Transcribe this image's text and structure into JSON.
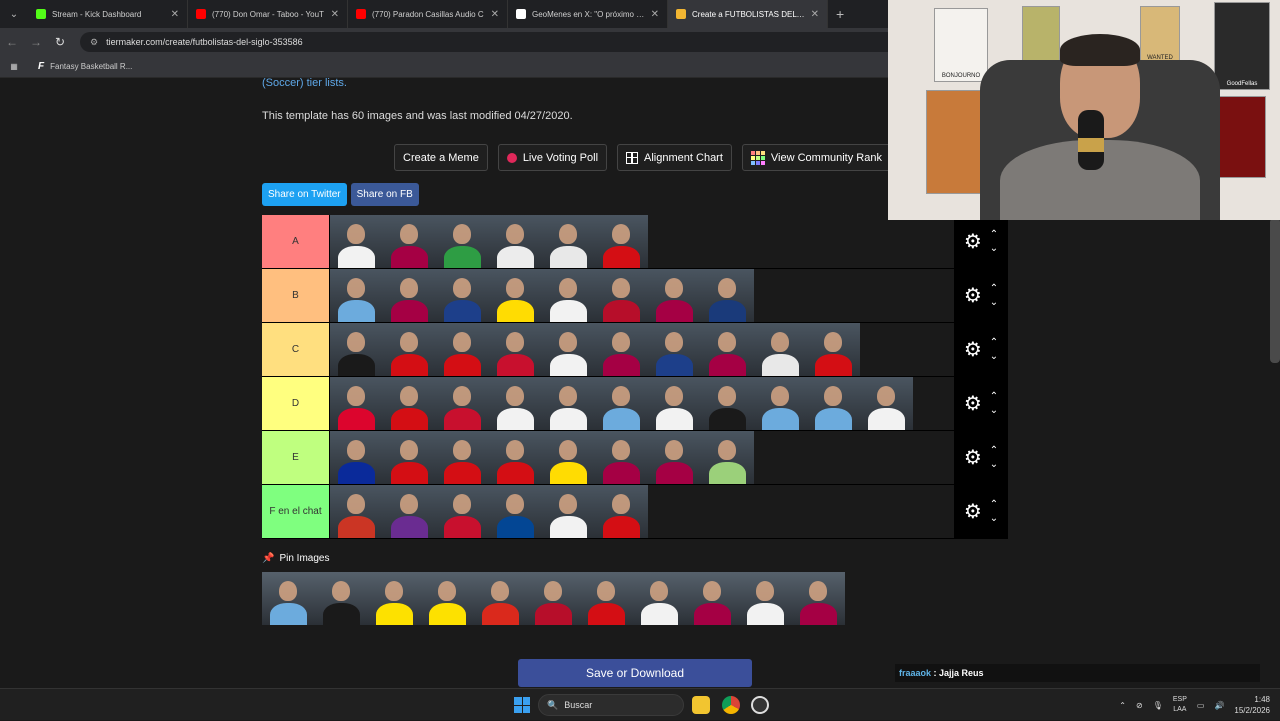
{
  "browser": {
    "tabs": [
      {
        "title": "Stream - Kick Dashboard",
        "color": "#53fc18",
        "active": false
      },
      {
        "title": "(770) Don Omar - Taboo - YouT",
        "color": "#ff0000",
        "active": false
      },
      {
        "title": "(770) Paradon Casillas Audio C",
        "color": "#ff0000",
        "active": false
      },
      {
        "title": "GeoMenes en X: \"O próximo só",
        "color": "#ffffff",
        "active": false
      },
      {
        "title": "Create a FUTBOLISTAS DEL SIG",
        "color": "#f2b632",
        "active": true
      }
    ],
    "url": "tiermaker.com/create/futbolistas-del-siglo-353586",
    "bookmark": "Fantasy Basketball R..."
  },
  "page": {
    "intro_link": "(Soccer) tier lists.",
    "meta_text": "This template has 60 images and was last modified 04/27/2020.",
    "buttons": {
      "meme": "Create a Meme",
      "poll": "Live Voting Poll",
      "alignment": "Alignment Chart",
      "community": "View Community Rank"
    },
    "share": {
      "twitter": "Share on Twitter",
      "facebook": "Share on FB"
    },
    "tiers": [
      {
        "label": "A",
        "color": "#ff7f7f",
        "count": 6,
        "shirts": [
          "#f2f2f2",
          "#a50044",
          "#2e9d44",
          "#ececec",
          "#e8e8e8",
          "#d40e14"
        ]
      },
      {
        "label": "B",
        "color": "#ffbf7f",
        "count": 8,
        "shirts": [
          "#6cabdd",
          "#a50044",
          "#1d3f8a",
          "#ffdc02",
          "#f2f2f2",
          "#b70e2a",
          "#a50044",
          "#1a3a7a"
        ]
      },
      {
        "label": "C",
        "color": "#ffdf7f",
        "count": 10,
        "shirts": [
          "#1a1a1a",
          "#d40e14",
          "#d40e14",
          "#c8102e",
          "#f2f2f2",
          "#a50044",
          "#1d3f8a",
          "#a50044",
          "#e8e8e8",
          "#d40e14"
        ]
      },
      {
        "label": "D",
        "color": "#ffff7f",
        "count": 11,
        "shirts": [
          "#dc052d",
          "#d40e14",
          "#c8102e",
          "#f2f2f2",
          "#f2f2f2",
          "#6cabdd",
          "#f2f2f2",
          "#1a1a1a",
          "#6cabdd",
          "#6cabdd",
          "#f2f2f2"
        ]
      },
      {
        "label": "E",
        "color": "#bfff7f",
        "count": 8,
        "shirts": [
          "#0a2a9a",
          "#d40e14",
          "#d40e14",
          "#d40e14",
          "#ffdc02",
          "#a50044",
          "#a50044",
          "#9bd07a"
        ]
      },
      {
        "label": "F en el chat",
        "color": "#7fff7f",
        "count": 6,
        "shirts": [
          "#cb3524",
          "#6a2c91",
          "#c8102e",
          "#034694",
          "#f2f2f2",
          "#d40e14"
        ]
      }
    ],
    "pin_label": "Pin Images",
    "pool_shirts": [
      "#6cabdd",
      "#1a1a1a",
      "#fde100",
      "#fde100",
      "#da291c",
      "#b70e2a",
      "#d40e14",
      "#f2f2f2",
      "#a50044",
      "#f2f2f2",
      "#a50044"
    ],
    "save_label": "Save or Download"
  },
  "chat": {
    "user": "fraaaok",
    "separator": " : ",
    "message": "Jajja Reus"
  },
  "taskbar": {
    "search_placeholder": "Buscar",
    "lang_top": "ESP",
    "lang_bottom": "LAA",
    "time": "1:48",
    "date": "15/2/2026"
  },
  "webcam": {
    "posters": [
      "BONJOURNO",
      "WANTED",
      "GoodFellas"
    ]
  }
}
